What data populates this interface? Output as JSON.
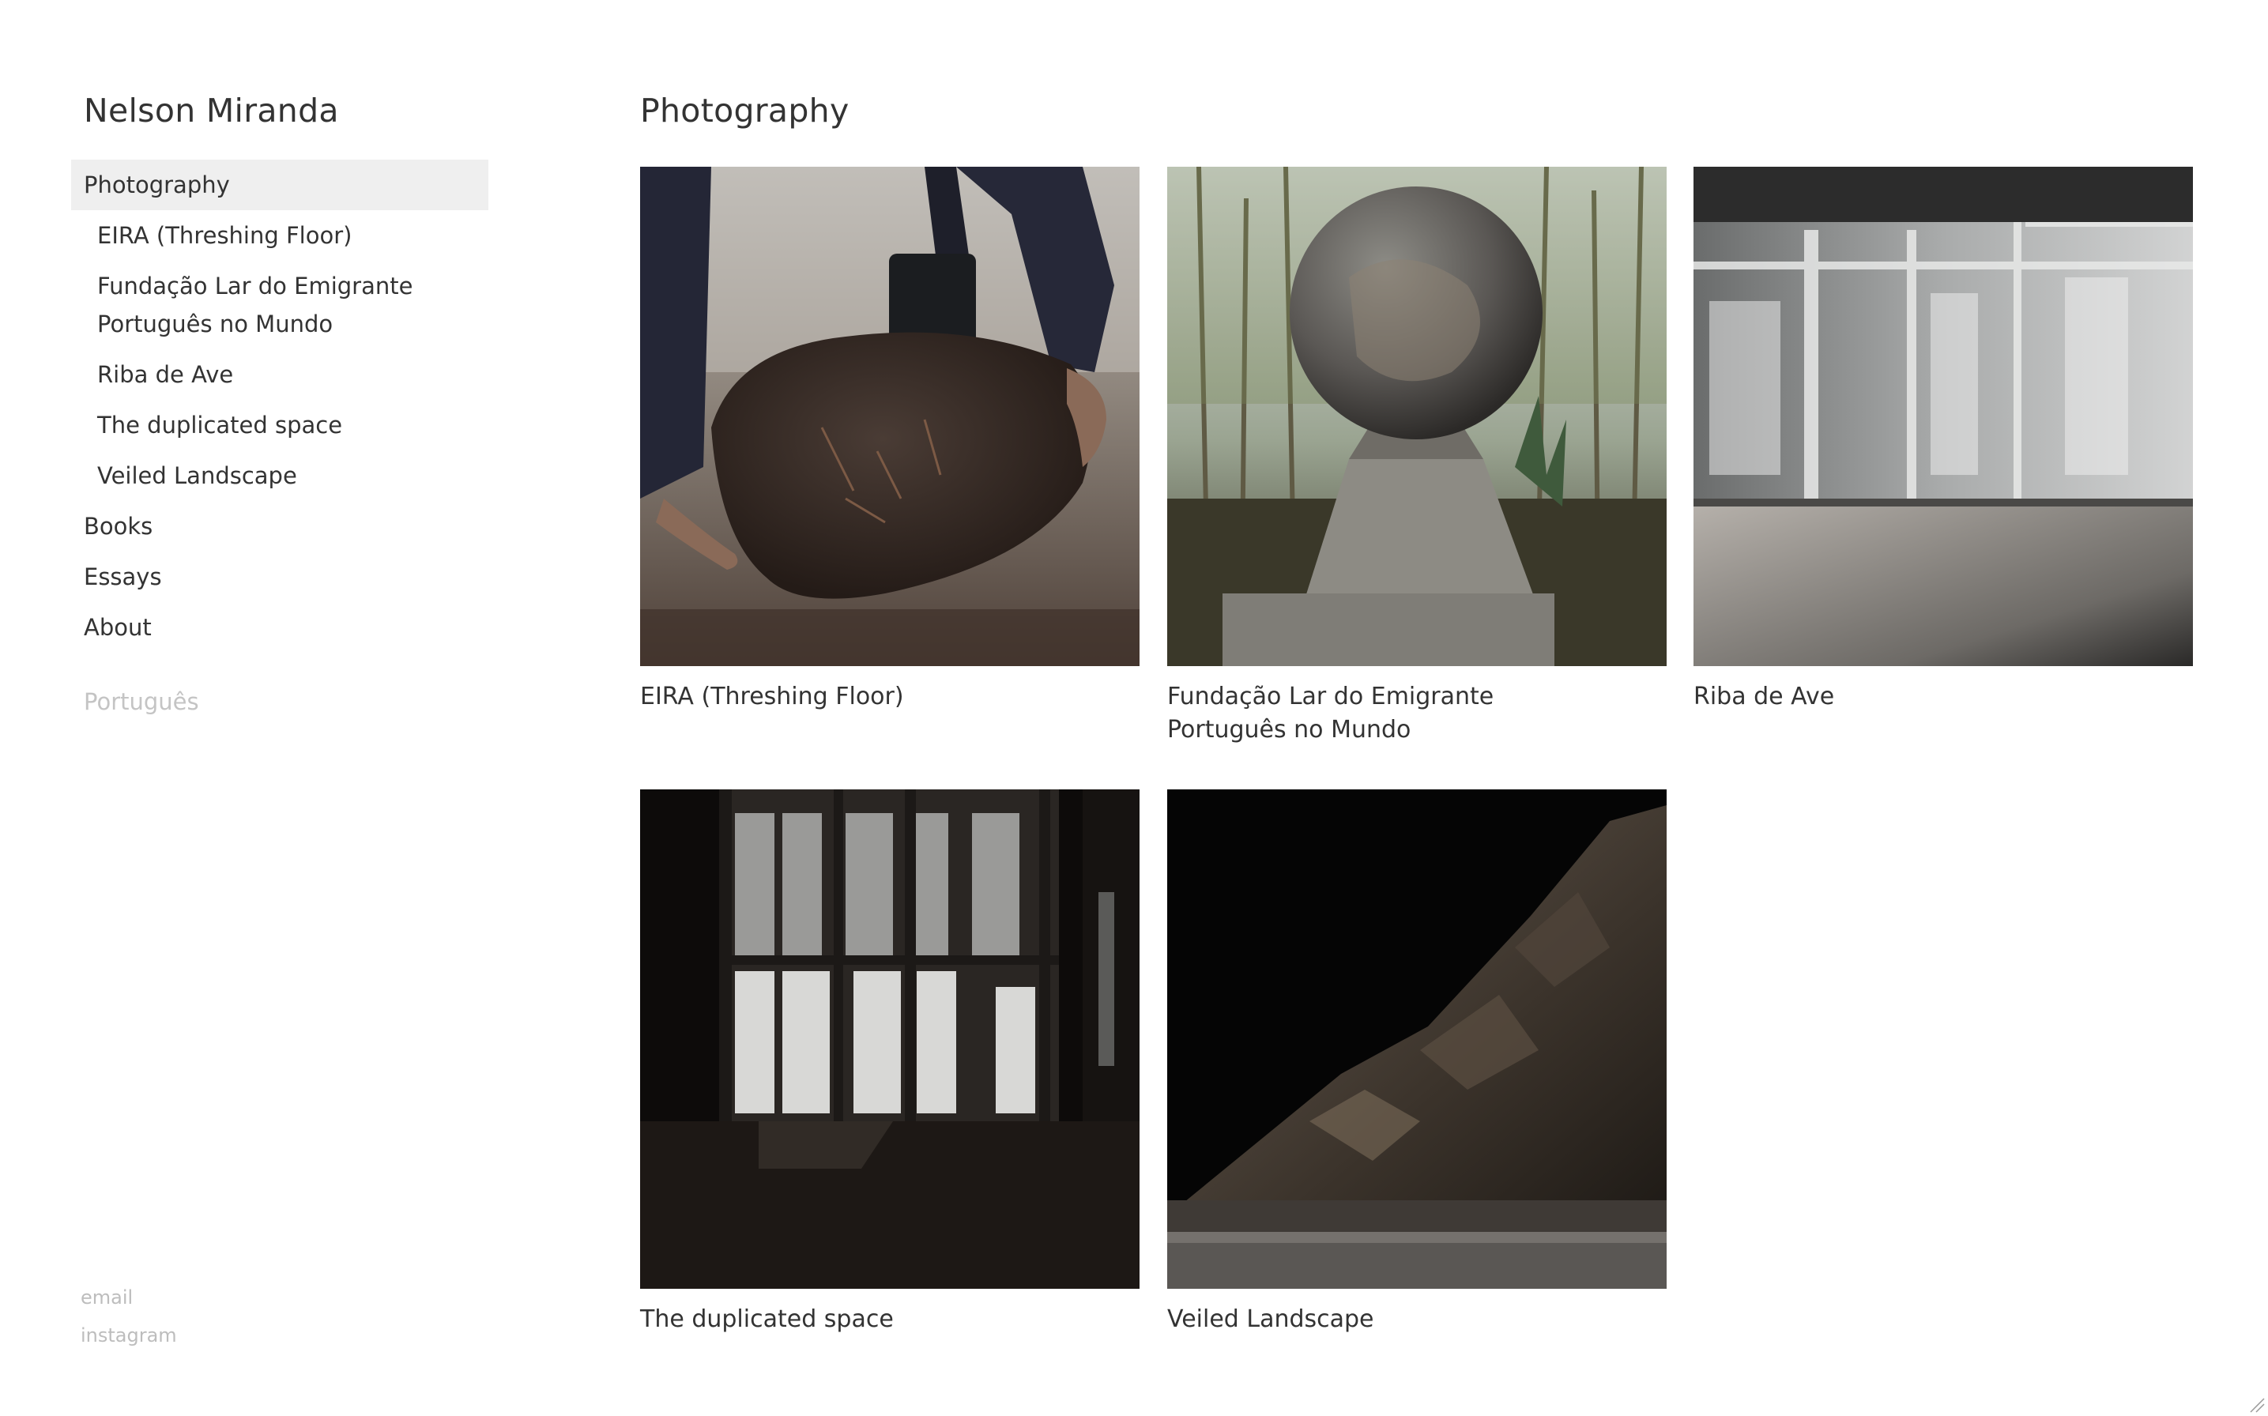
{
  "site": {
    "title": "Nelson Miranda"
  },
  "nav": {
    "items": [
      {
        "label": "Photography",
        "active": true
      },
      {
        "label": "EIRA (Threshing Floor)"
      },
      {
        "label_line1": "Fundação Lar do Emigrante",
        "label_line2": "Português no Mundo"
      },
      {
        "label": "Riba de Ave"
      },
      {
        "label": "The duplicated space"
      },
      {
        "label": "Veiled Landscape"
      },
      {
        "label": "Books"
      },
      {
        "label": "Essays"
      },
      {
        "label": "About"
      }
    ],
    "language": "Português"
  },
  "footer": {
    "email": "email",
    "instagram": "instagram"
  },
  "main": {
    "title": "Photography",
    "projects": [
      {
        "caption": "EIRA (Threshing Floor)",
        "image": "hands-lifting-clod-photo"
      },
      {
        "caption_line1": "Fundação Lar do Emigrante",
        "caption_line2": "Português no Mundo",
        "image": "stone-globe-monument-photo"
      },
      {
        "caption": "Riba de Ave",
        "image": "sunlit-windows-interior-photo"
      },
      {
        "caption": "The duplicated space",
        "image": "dark-window-interior-photo"
      },
      {
        "caption": "Veiled Landscape",
        "image": "rock-slope-night-photo"
      }
    ]
  }
}
